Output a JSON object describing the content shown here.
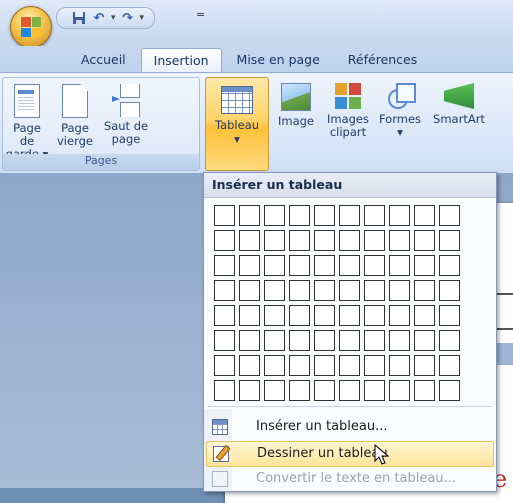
{
  "quick_access": {
    "items": [
      "save-icon",
      "undo-icon",
      "redo-icon"
    ],
    "more_glyph": "="
  },
  "tabs": [
    {
      "label": "Accueil",
      "active": false
    },
    {
      "label": "Insertion",
      "active": true
    },
    {
      "label": "Mise en page",
      "active": false
    },
    {
      "label": "Références",
      "active": false
    }
  ],
  "ribbon": {
    "pages_group": {
      "label": "Pages",
      "buttons": [
        {
          "line1": "Page de",
          "line2": "garde ▾"
        },
        {
          "line1": "Page",
          "line2": "vierge"
        },
        {
          "line1": "Saut de",
          "line2": "page"
        }
      ]
    },
    "table_button": {
      "line1": "Tableau",
      "line2": "▾"
    },
    "illustrations": [
      {
        "line1": "Image",
        "line2": ""
      },
      {
        "line1": "Images",
        "line2": "clipart"
      },
      {
        "line1": "Formes",
        "line2": "▾"
      },
      {
        "line1": "SmartArt",
        "line2": ""
      }
    ]
  },
  "dropdown": {
    "header": "Insérer un tableau",
    "grid": {
      "columns": 10,
      "rows": 8
    },
    "items": [
      {
        "label": "Insérer un tableau...",
        "state": "normal"
      },
      {
        "label": "Dessiner un tableau",
        "state": "highlighted"
      },
      {
        "label": "Convertir le texte en tableau...",
        "state": "disabled"
      }
    ]
  },
  "document": {
    "partial_text": "e ("
  },
  "colors": {
    "ribbon_active": "#ffd36a",
    "highlight": "#ffe59a",
    "doc_red": "#c62828"
  }
}
